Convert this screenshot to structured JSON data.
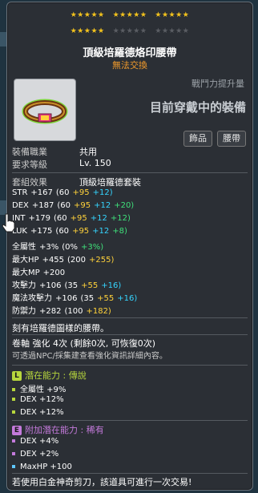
{
  "stars": {
    "row1_filled": 15,
    "row2_filled": 5,
    "row2_empty": 10
  },
  "item": {
    "name": "頂級培羅德烙印腰帶",
    "trade_note": "無法交換",
    "power_label": "戰鬥力提升量",
    "power_value": "目前穿戴中的裝備",
    "tag_accessory": "飾品",
    "tag_belt": "腰帶"
  },
  "info": {
    "job_label": "裝備職業",
    "job_value": "共用",
    "level_label": "要求等級",
    "level_value": "Lv. 150",
    "set_label": "套組效果",
    "set_value": "頂級培羅德套裝"
  },
  "stats": [
    {
      "name": "STR",
      "total": "+167",
      "base": "(60",
      "b1": "+95",
      "b2": "+12)",
      "b2c": "cyan",
      "b3": ""
    },
    {
      "name": "DEX",
      "total": "+187",
      "base": "(60",
      "b1": "+95",
      "b2": "+12",
      "b2c": "cyan",
      "b3": "+20)"
    },
    {
      "name": "INT",
      "total": "+179",
      "base": "(60",
      "b1": "+95",
      "b2": "+12",
      "b2c": "cyan",
      "b3": "+12)"
    },
    {
      "name": "LUK",
      "total": "+175",
      "base": "(60",
      "b1": "+95",
      "b2": "+12",
      "b2c": "cyan",
      "b3": "+8)"
    },
    {
      "name": "全屬性",
      "total": "+3%",
      "base": "(0%",
      "b1": "+3%)",
      "b1c": "green",
      "b2": "",
      "b3": ""
    },
    {
      "name": "最大HP",
      "total": "+455",
      "base": "(200",
      "b1": "+255)",
      "b2": "",
      "b3": ""
    },
    {
      "name": "最大MP",
      "total": "+200",
      "base": "",
      "b1": "",
      "b2": "",
      "b3": ""
    },
    {
      "name": "攻擊力",
      "total": "+106",
      "base": "(35",
      "b1": "+55",
      "b2": "+16)",
      "b2c": "cyan",
      "b3": ""
    },
    {
      "name": "魔法攻擊力",
      "total": "+106",
      "base": "(35",
      "b1": "+55",
      "b2": "+16)",
      "b2c": "cyan",
      "b3": ""
    },
    {
      "name": "防禦力",
      "total": "+282",
      "base": "(100",
      "b1": "+182)",
      "b2": "",
      "b3": ""
    }
  ],
  "description": "刻有培羅德圖樣的腰帶。",
  "scroll_line": "卷軸 強化 4次 (剩餘0次, 可恢復0次)",
  "scroll_note": "可透過NPC/採集建查看強化資訊詳細內容。",
  "potential": {
    "label": "潛在能力 : 傳說",
    "icon": "L",
    "lines": [
      "全屬性 +9%",
      "DEX +12%",
      "DEX +12%"
    ]
  },
  "bonus_potential": {
    "label": "附加潛在能力 : 稀有",
    "icon": "E",
    "lines": [
      "DEX +4%",
      "DEX +2%",
      "MaxHP +100"
    ]
  },
  "hint": "若使用白金神奇剪刀，該道具可進行一次交易!",
  "colors": {
    "legend": "#b7d63d",
    "rare": "#c47adb",
    "bonus": "#ffd23a",
    "star": "#f2c21d"
  }
}
